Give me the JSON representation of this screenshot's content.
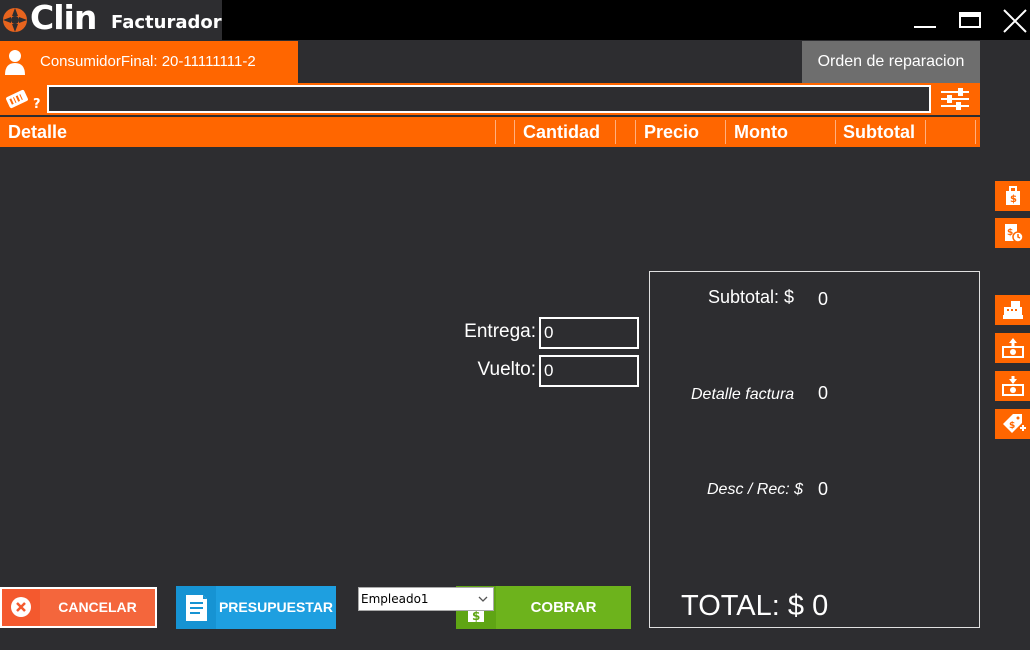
{
  "app": {
    "logo_text": "Clin",
    "title": "Facturador"
  },
  "customer": {
    "label": "ConsumidorFinal: 20-11111111-2"
  },
  "orden_button": "Orden de reparacion",
  "search": {
    "hint": "?",
    "value": ""
  },
  "table": {
    "columns": [
      "Detalle",
      "Cantidad",
      "Precio",
      "Monto",
      "Subtotal"
    ],
    "rows": []
  },
  "payment": {
    "entrega_label": "Entrega:",
    "entrega_value": "0",
    "vuelto_label": "Vuelto:",
    "vuelto_value": "0"
  },
  "summary": {
    "subtotal_label": "Subtotal: $",
    "subtotal_value": "0",
    "detalle_label": "Detalle factura",
    "detalle_value": "0",
    "desc_label": "Desc / Rec: $",
    "desc_value": "0",
    "total_label": "TOTAL: $ 0"
  },
  "buttons": {
    "cancel": "CANCELAR",
    "presupuestar": "PRESUPUESTAR",
    "cobrar": "COBRAR"
  },
  "employee": {
    "selected": "Empleado1"
  },
  "side_icons": [
    "price-tag-icon",
    "bill-refresh-icon",
    "cash-register-icon",
    "cash-in-icon",
    "cash-out-icon",
    "discount-tag-icon"
  ],
  "colors": {
    "accent": "#ff6600",
    "background": "#2d2d30",
    "cancel": "#f4592e",
    "presupuestar": "#1e9fe0",
    "cobrar": "#6db31c"
  }
}
